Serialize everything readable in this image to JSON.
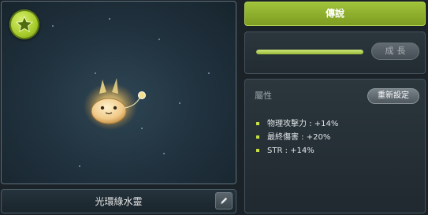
{
  "pet": {
    "name": "光環綠水靈",
    "badge_icon": "star-icon",
    "edit_icon": "pencil-icon"
  },
  "rank": {
    "label": "傳說"
  },
  "growth": {
    "button_label": "成長",
    "progress_fraction": 1.0
  },
  "attributes": {
    "title": "屬性",
    "reset_label": "重新設定",
    "items": [
      {
        "text": "物理攻擊力 : +14%"
      },
      {
        "text": "最終傷害 : +20%"
      },
      {
        "text": "STR : +14%"
      }
    ]
  },
  "colors": {
    "accent": "#9fc23a",
    "bullet": "#c6e045"
  }
}
